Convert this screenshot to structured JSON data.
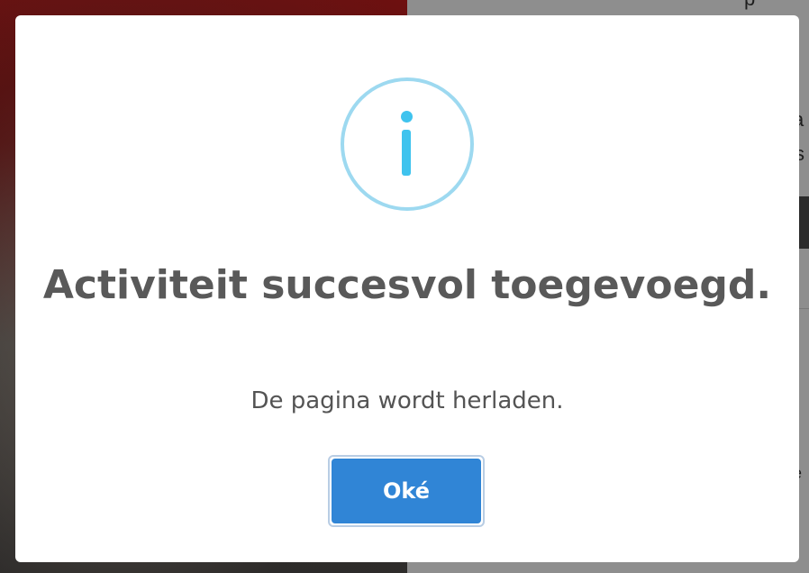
{
  "background": {
    "right_glyphs": [
      "p",
      "a",
      "s",
      "e"
    ]
  },
  "dialog": {
    "icon": "info-icon",
    "title": "Activiteit succesvol toegevoegd.",
    "message": "De pagina wordt herladen.",
    "confirm_label": "Oké"
  },
  "colors": {
    "icon_border": "#9dd9f0",
    "icon_fill": "#3fc3ee",
    "title_text": "#595959",
    "confirm_button": "#3085d6",
    "confirm_focus_ring": "#b8cde4"
  }
}
